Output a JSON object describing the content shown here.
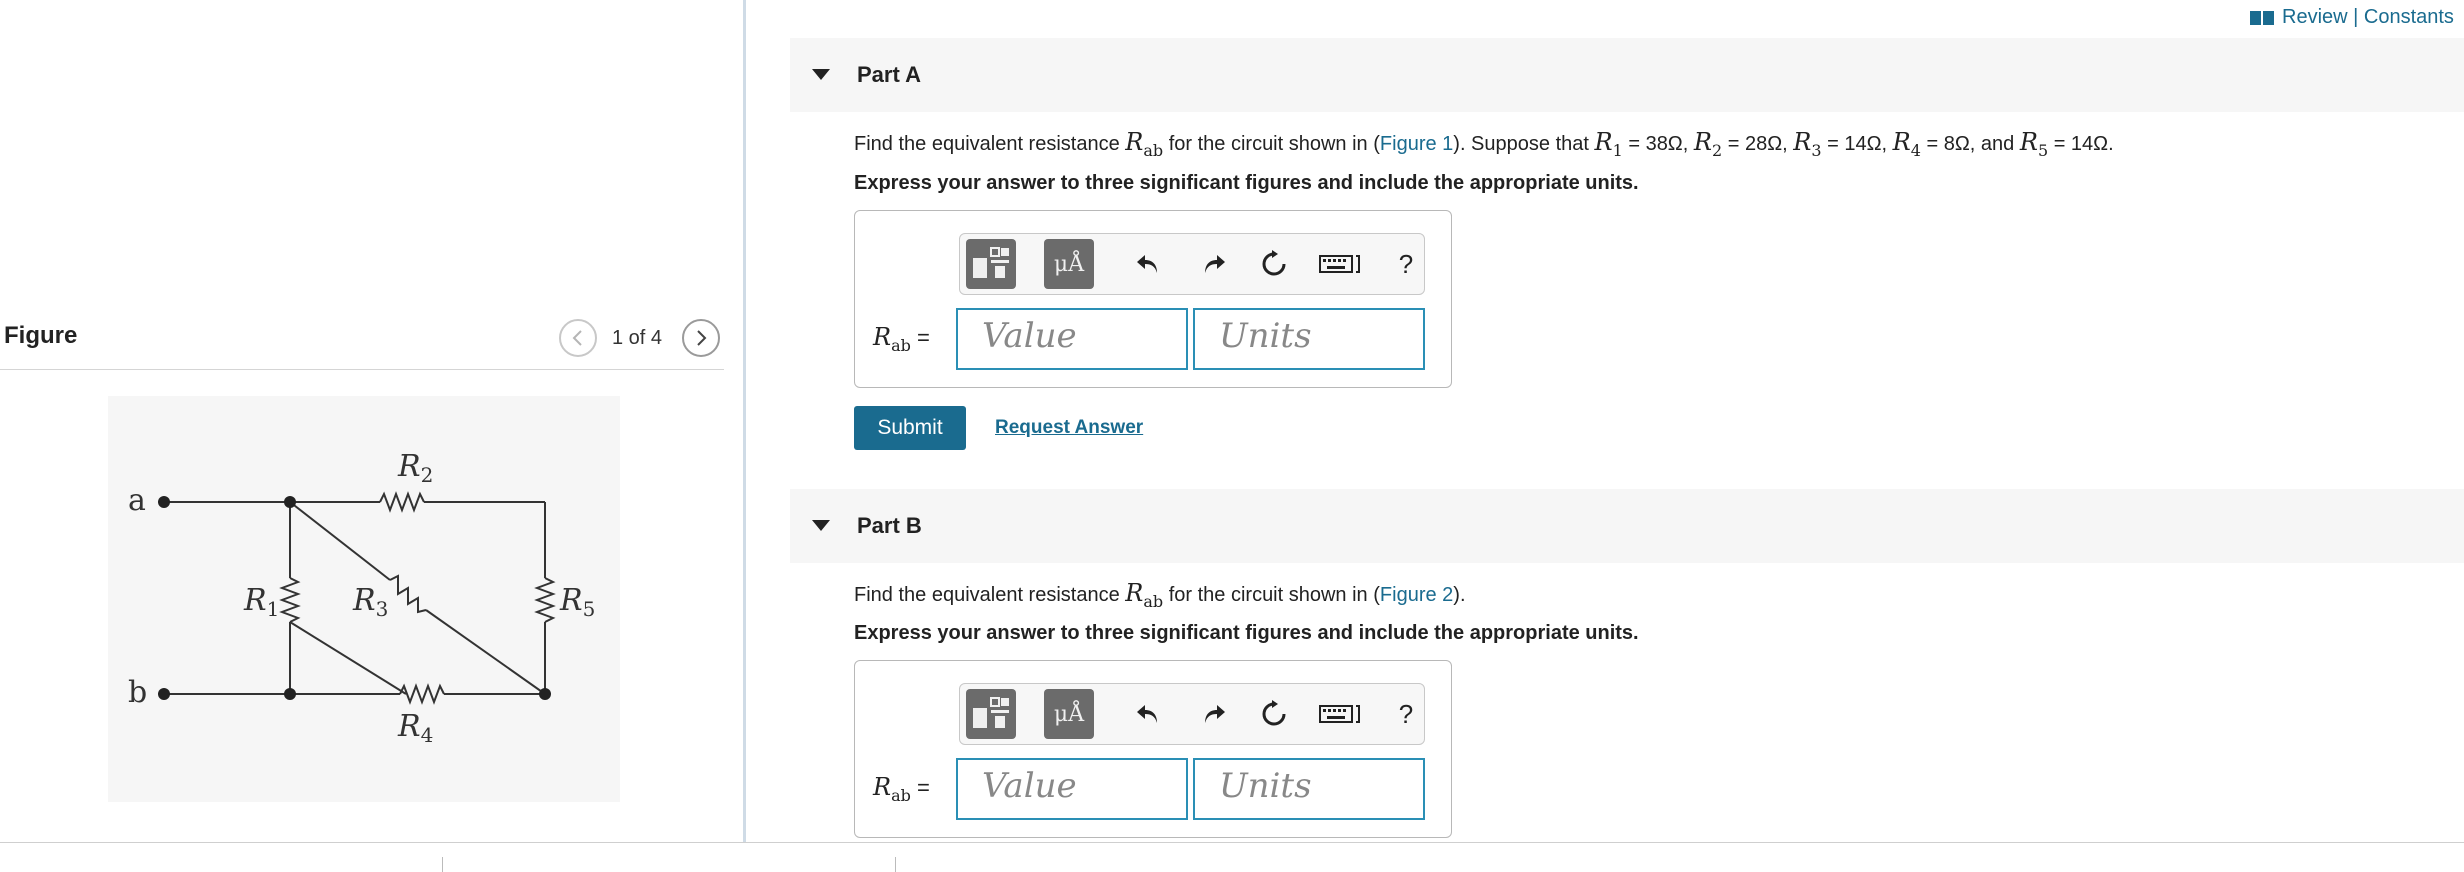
{
  "header": {
    "review_link": "Review | Constants"
  },
  "figure_panel": {
    "title": "Figure",
    "pager": "1 of 4",
    "circuit_labels": {
      "node_a": "a",
      "node_b": "b",
      "r1": "R",
      "r1_sub": "1",
      "r2": "R",
      "r2_sub": "2",
      "r3": "R",
      "r3_sub": "3",
      "r4": "R",
      "r4_sub": "4",
      "r5": "R",
      "r5_sub": "5"
    }
  },
  "part_a": {
    "title": "Part A",
    "q_pre": "Find the equivalent resistance",
    "q_sym": "R",
    "q_sub": "ab",
    "q_mid": "for the circuit shown in (",
    "q_link": "Figure 1",
    "q_after": "). Suppose that",
    "r1_sym": "R",
    "r1_sub": "1",
    "r1_val": "= 38Ω,",
    "r2_sym": "R",
    "r2_sub": "2",
    "r2_val": "= 28Ω,",
    "r3_sym": "R",
    "r3_sub": "3",
    "r3_val": "= 14Ω,",
    "r4_sym": "R",
    "r4_sub": "4",
    "r4_val": "= 8Ω, and",
    "r5_sym": "R",
    "r5_sub": "5",
    "r5_val": "= 14Ω.",
    "instruction": "Express your answer to three significant figures and include the appropriate units.",
    "answer_label_sym": "R",
    "answer_label_sub": "ab",
    "answer_label_eq": "=",
    "value_placeholder": "Value",
    "units_placeholder": "Units",
    "submit": "Submit",
    "request": "Request Answer"
  },
  "part_b": {
    "title": "Part B",
    "q_pre": "Find the equivalent resistance",
    "q_sym": "R",
    "q_sub": "ab",
    "q_mid": "for the circuit shown in (",
    "q_link": "Figure 2",
    "q_after": ").",
    "instruction": "Express your answer to three significant figures and include the appropriate units.",
    "answer_label_sym": "R",
    "answer_label_sub": "ab",
    "answer_label_eq": "=",
    "value_placeholder": "Value",
    "units_placeholder": "Units"
  },
  "toolbar": {
    "units_button": "μÅ",
    "help": "?",
    "icons": [
      "templates-icon",
      "units-icon",
      "undo-icon",
      "redo-icon",
      "reset-icon",
      "keyboard-icon",
      "help-icon"
    ]
  },
  "colors": {
    "accent": "#1a6b8f",
    "input_border": "#2a8fb5",
    "toolbar_button": "#6b6b6b",
    "header_bg": "#f6f6f6"
  }
}
